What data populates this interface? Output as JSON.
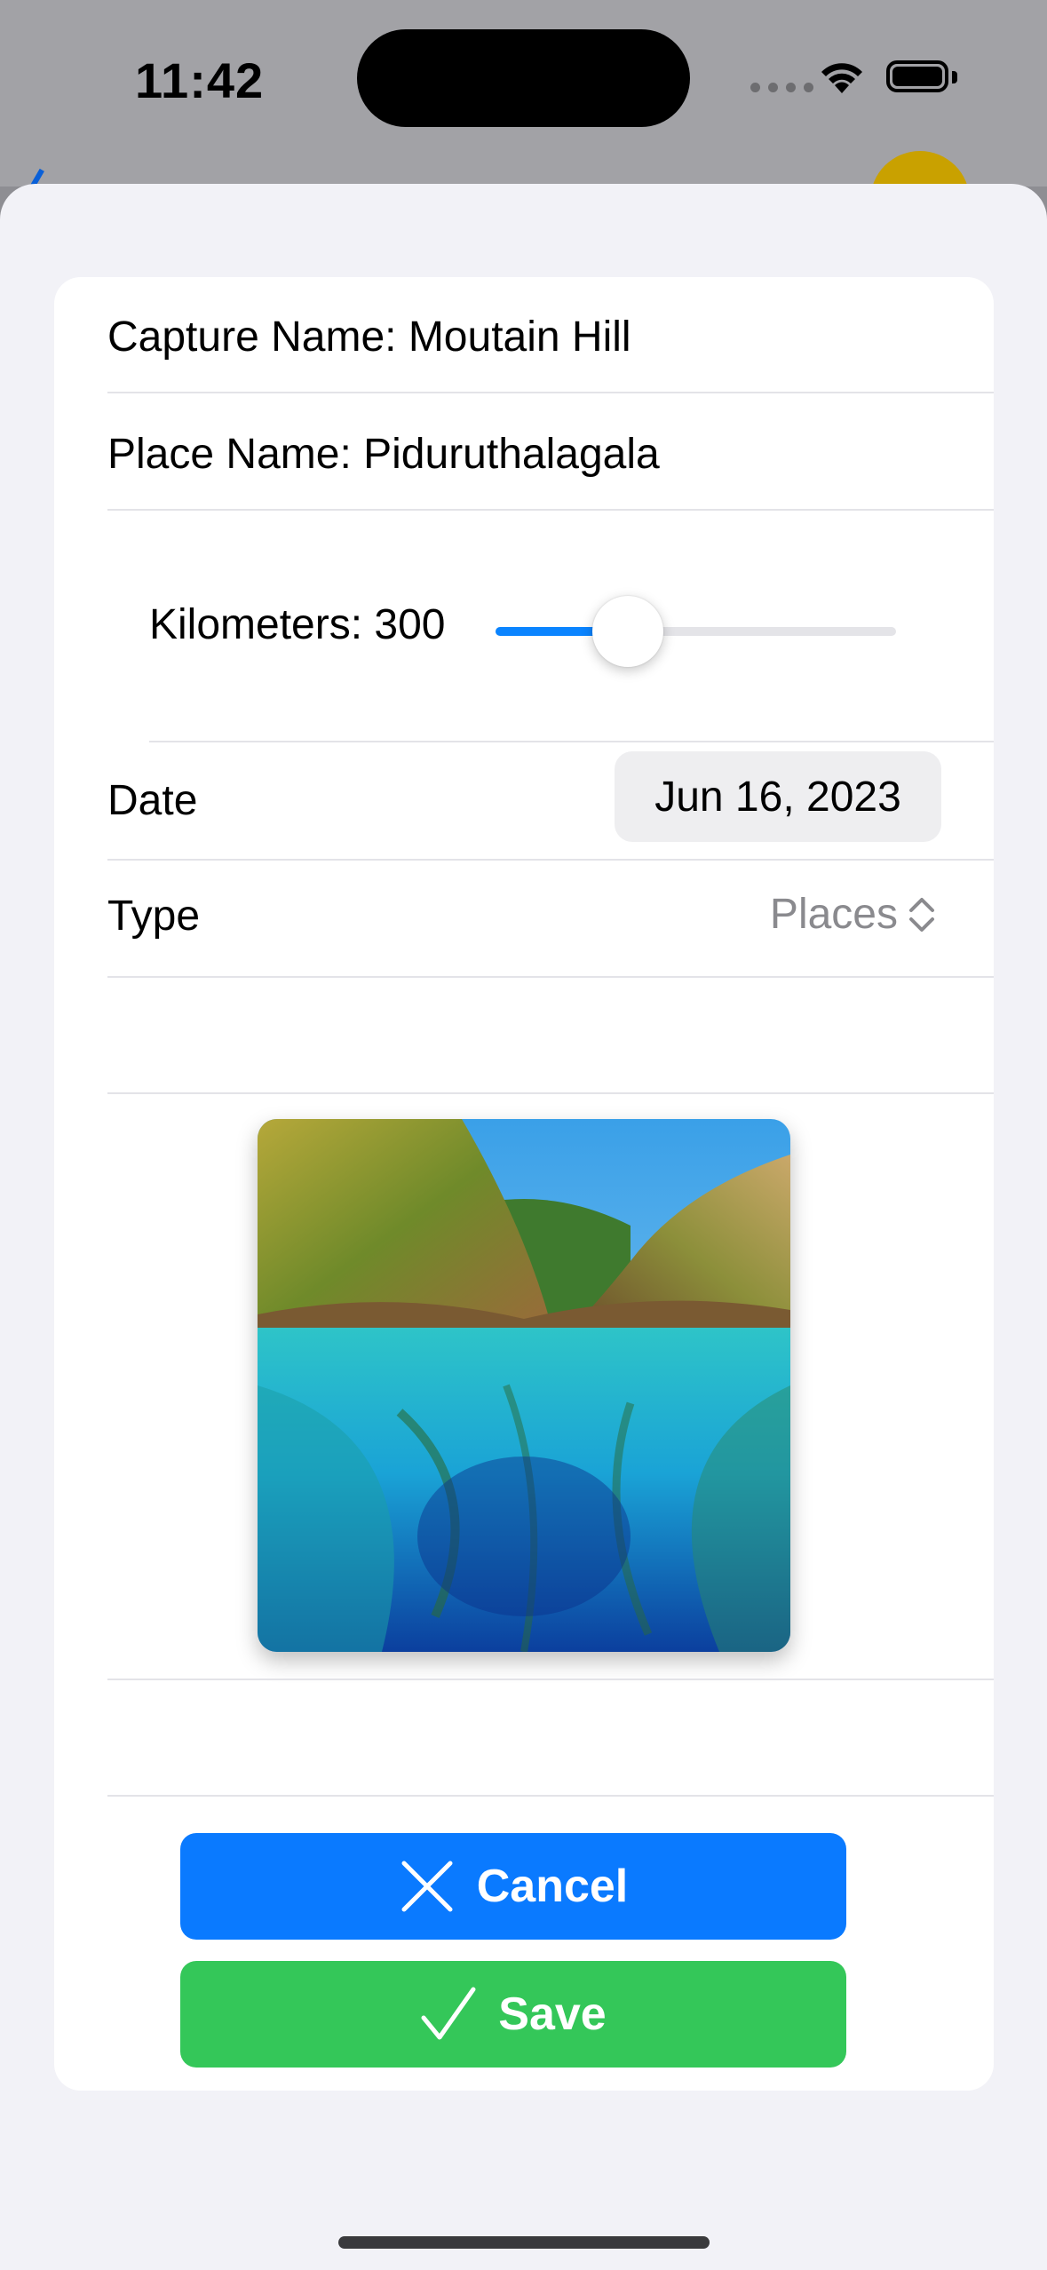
{
  "status_bar": {
    "time": "11:42"
  },
  "form": {
    "capture_name": "Capture Name:  Moutain Hill",
    "place_name": "Place Name:  Piduruthalagala",
    "kilometers_label": "Kilometers: 300",
    "kilometers_fraction": 0.33,
    "date_label": "Date",
    "date_value": "Jun 16, 2023",
    "type_label": "Type",
    "type_value": "Places"
  },
  "photo": {
    "description_icon": "landscape-photo"
  },
  "actions": {
    "cancel_label": "Cancel",
    "save_label": "Save"
  },
  "colors": {
    "accent_blue": "#0A7AFF",
    "save_green": "#34C759",
    "slider_blue": "#0A84FF",
    "secondary_text": "#8A8A8E"
  }
}
